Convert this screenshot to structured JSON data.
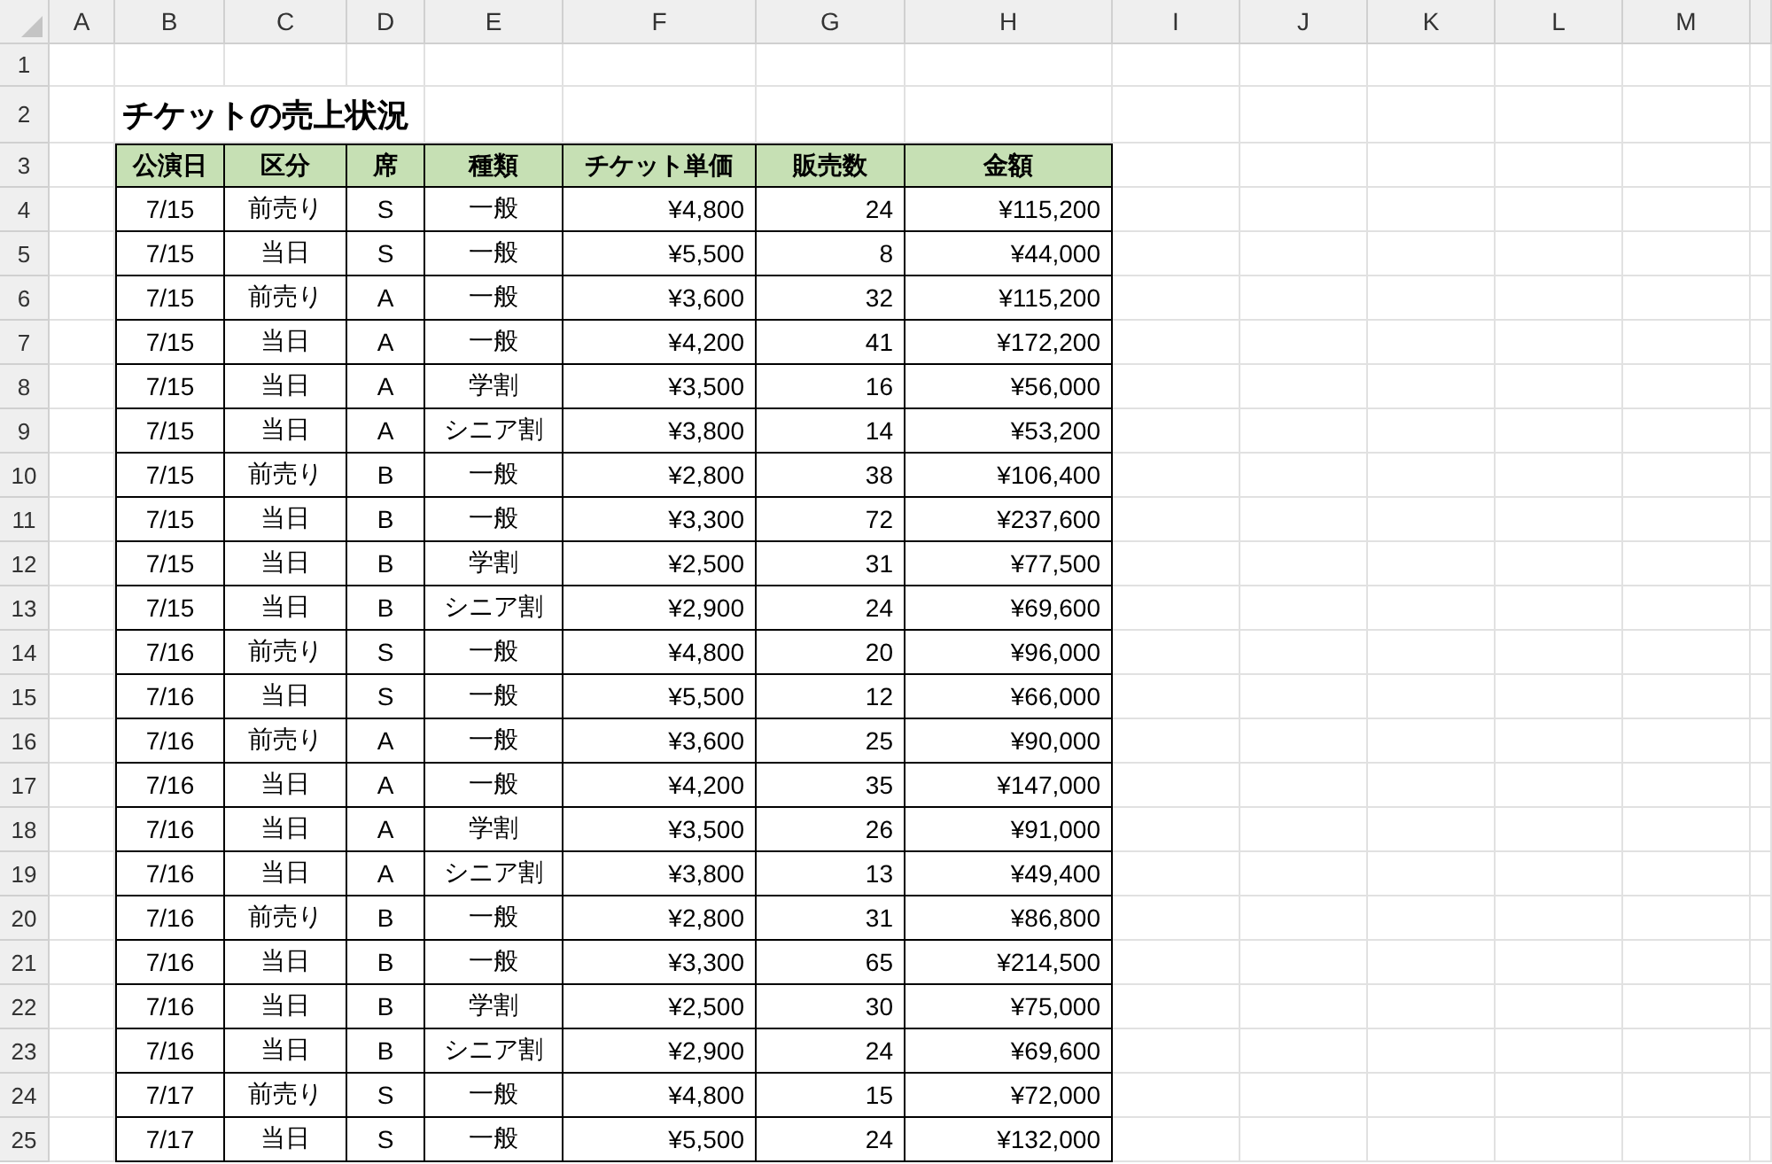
{
  "column_headers": [
    "A",
    "B",
    "C",
    "D",
    "E",
    "F",
    "G",
    "H",
    "I",
    "J",
    "K",
    "L",
    "M"
  ],
  "row_numbers": [
    "1",
    "2",
    "3",
    "4",
    "5",
    "6",
    "7",
    "8",
    "9",
    "10",
    "11",
    "12",
    "13",
    "14",
    "15",
    "16",
    "17",
    "18",
    "19",
    "20",
    "21",
    "22",
    "23",
    "24",
    "25"
  ],
  "title": "チケットの売上状況",
  "table": {
    "columns": [
      "公演日",
      "区分",
      "席",
      "種類",
      "チケット単価",
      "販売数",
      "金額"
    ],
    "rows": [
      [
        "7/15",
        "前売り",
        "S",
        "一般",
        "¥4,800",
        "24",
        "¥115,200"
      ],
      [
        "7/15",
        "当日",
        "S",
        "一般",
        "¥5,500",
        "8",
        "¥44,000"
      ],
      [
        "7/15",
        "前売り",
        "A",
        "一般",
        "¥3,600",
        "32",
        "¥115,200"
      ],
      [
        "7/15",
        "当日",
        "A",
        "一般",
        "¥4,200",
        "41",
        "¥172,200"
      ],
      [
        "7/15",
        "当日",
        "A",
        "学割",
        "¥3,500",
        "16",
        "¥56,000"
      ],
      [
        "7/15",
        "当日",
        "A",
        "シニア割",
        "¥3,800",
        "14",
        "¥53,200"
      ],
      [
        "7/15",
        "前売り",
        "B",
        "一般",
        "¥2,800",
        "38",
        "¥106,400"
      ],
      [
        "7/15",
        "当日",
        "B",
        "一般",
        "¥3,300",
        "72",
        "¥237,600"
      ],
      [
        "7/15",
        "当日",
        "B",
        "学割",
        "¥2,500",
        "31",
        "¥77,500"
      ],
      [
        "7/15",
        "当日",
        "B",
        "シニア割",
        "¥2,900",
        "24",
        "¥69,600"
      ],
      [
        "7/16",
        "前売り",
        "S",
        "一般",
        "¥4,800",
        "20",
        "¥96,000"
      ],
      [
        "7/16",
        "当日",
        "S",
        "一般",
        "¥5,500",
        "12",
        "¥66,000"
      ],
      [
        "7/16",
        "前売り",
        "A",
        "一般",
        "¥3,600",
        "25",
        "¥90,000"
      ],
      [
        "7/16",
        "当日",
        "A",
        "一般",
        "¥4,200",
        "35",
        "¥147,000"
      ],
      [
        "7/16",
        "当日",
        "A",
        "学割",
        "¥3,500",
        "26",
        "¥91,000"
      ],
      [
        "7/16",
        "当日",
        "A",
        "シニア割",
        "¥3,800",
        "13",
        "¥49,400"
      ],
      [
        "7/16",
        "前売り",
        "B",
        "一般",
        "¥2,800",
        "31",
        "¥86,800"
      ],
      [
        "7/16",
        "当日",
        "B",
        "一般",
        "¥3,300",
        "65",
        "¥214,500"
      ],
      [
        "7/16",
        "当日",
        "B",
        "学割",
        "¥2,500",
        "30",
        "¥75,000"
      ],
      [
        "7/16",
        "当日",
        "B",
        "シニア割",
        "¥2,900",
        "24",
        "¥69,600"
      ],
      [
        "7/17",
        "前売り",
        "S",
        "一般",
        "¥4,800",
        "15",
        "¥72,000"
      ],
      [
        "7/17",
        "当日",
        "S",
        "一般",
        "¥5,500",
        "24",
        "¥132,000"
      ]
    ]
  }
}
